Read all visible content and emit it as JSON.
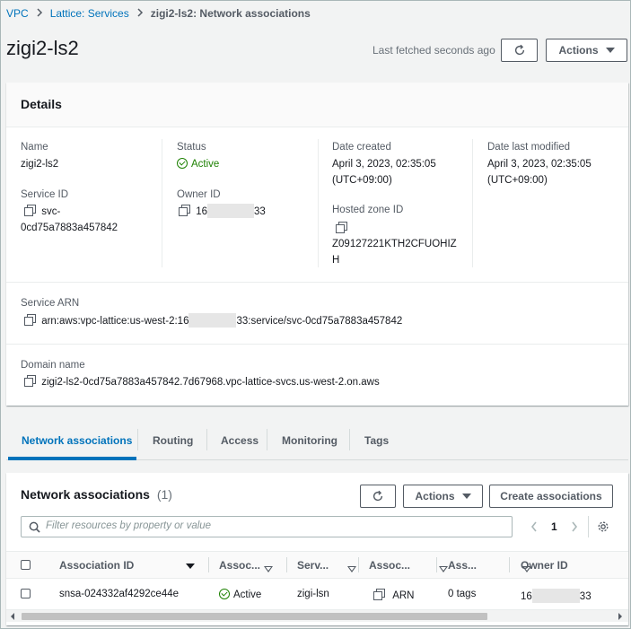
{
  "breadcrumb": {
    "items": [
      "VPC",
      "Lattice: Services"
    ],
    "current": "zigi2-ls2: Network associations"
  },
  "header": {
    "title": "zigi2-ls2",
    "last_fetched": "Last fetched seconds ago",
    "actions_label": "Actions"
  },
  "details": {
    "title": "Details",
    "name_label": "Name",
    "name_value": "zigi2-ls2",
    "service_id_label": "Service ID",
    "service_id_line1": "svc-",
    "service_id_line2": "0cd75a7883a457842",
    "status_label": "Status",
    "status_value": "Active",
    "owner_id_label": "Owner ID",
    "owner_id_prefix": "16",
    "owner_id_suffix": "33",
    "date_created_label": "Date created",
    "date_created_line1": "April 3, 2023, 02:35:05",
    "date_created_line2": "(UTC+09:00)",
    "hosted_zone_label": "Hosted zone ID",
    "hosted_zone_line1": "Z09127221KTH2CFUOHIZ",
    "hosted_zone_line2": "H",
    "date_modified_label": "Date last modified",
    "date_modified_line1": "April 3, 2023, 02:35:05",
    "date_modified_line2": "(UTC+09:00)",
    "service_arn_label": "Service ARN",
    "service_arn_prefix": "arn:aws:vpc-lattice:us-west-2:16",
    "service_arn_suffix": "33:service/svc-0cd75a7883a457842",
    "domain_label": "Domain name",
    "domain_value": "zigi2-ls2-0cd75a7883a457842.7d67968.vpc-lattice-svcs.us-west-2.on.aws"
  },
  "tabs": [
    {
      "label": "Network associations",
      "active": true
    },
    {
      "label": "Routing"
    },
    {
      "label": "Access"
    },
    {
      "label": "Monitoring"
    },
    {
      "label": "Tags"
    }
  ],
  "assoc": {
    "title": "Network associations",
    "count": "(1)",
    "actions_label": "Actions",
    "create_label": "Create associations",
    "filter_placeholder": "Filter resources by property or value",
    "page": "1",
    "columns": [
      "Association ID",
      "Assoc...",
      "Serv...",
      "Assoc...",
      "Ass...",
      "Owner ID"
    ],
    "row": {
      "id": "snsa-024332af4292ce44e",
      "status": "Active",
      "service": "zigi-lsn",
      "type": "ARN",
      "tags": "0 tags",
      "owner_prefix": "16",
      "owner_suffix": "33"
    }
  },
  "colors": {
    "link": "#0073bb",
    "success": "#1d8102",
    "text": "#16191f",
    "muted": "#545b64"
  }
}
